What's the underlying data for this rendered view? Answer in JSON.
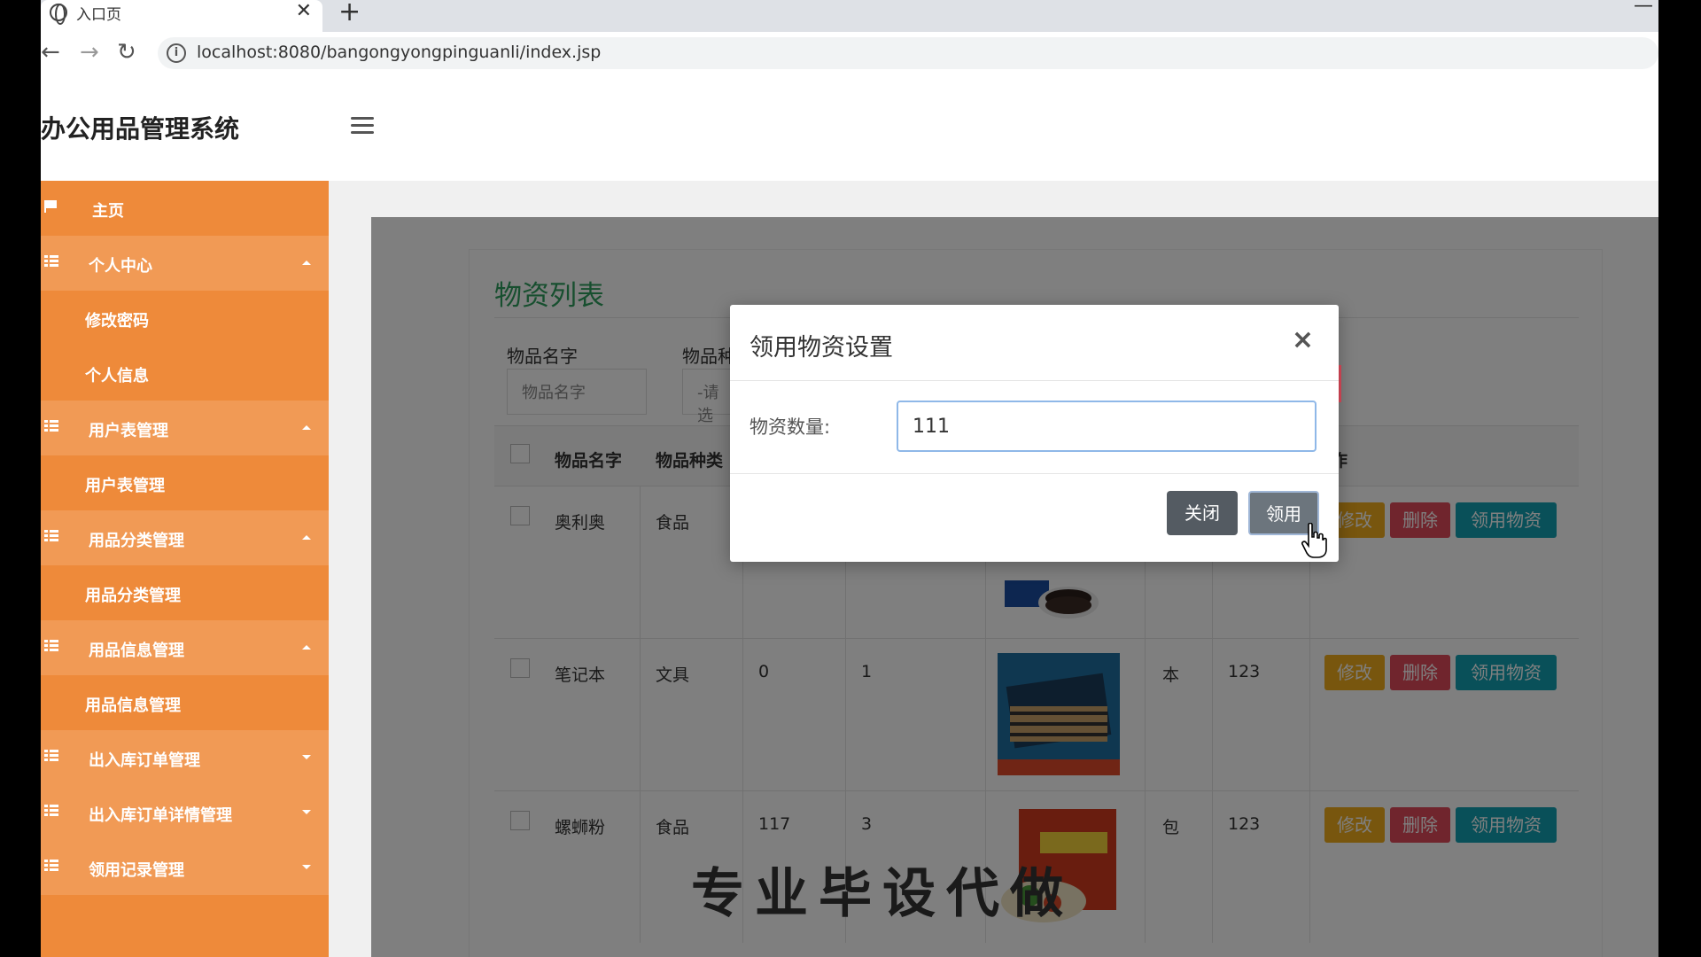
{
  "browser": {
    "tab_title": "入口页",
    "tab_close": "✕",
    "new_tab": "+",
    "url": "localhost:8080/bangongyongpinguanli/index.jsp",
    "minimize": "—"
  },
  "app": {
    "title": "办公用品管理系统"
  },
  "sidebar": {
    "items": [
      {
        "label": "主页",
        "kind": "home",
        "icon": "flag-icon"
      },
      {
        "label": "个人中心",
        "kind": "parent",
        "icon": "grid-icon",
        "caret": "up"
      },
      {
        "label": "修改密码",
        "kind": "child"
      },
      {
        "label": "个人信息",
        "kind": "child"
      },
      {
        "label": "用户表管理",
        "kind": "parent",
        "icon": "grid-icon",
        "caret": "up"
      },
      {
        "label": "用户表管理",
        "kind": "child"
      },
      {
        "label": "用品分类管理",
        "kind": "parent",
        "icon": "grid-icon",
        "caret": "up"
      },
      {
        "label": "用品分类管理",
        "kind": "child"
      },
      {
        "label": "用品信息管理",
        "kind": "parent",
        "icon": "grid-icon",
        "caret": "up"
      },
      {
        "label": "用品信息管理",
        "kind": "child"
      },
      {
        "label": "出入库订单管理",
        "kind": "parent",
        "icon": "grid-icon",
        "caret": "down"
      },
      {
        "label": "出入库订单详情管理",
        "kind": "parent",
        "icon": "grid-icon",
        "caret": "down"
      },
      {
        "label": "领用记录管理",
        "kind": "parent",
        "icon": "grid-icon",
        "caret": "down"
      }
    ]
  },
  "main": {
    "list_title": "物资列表",
    "search": {
      "name_label": "物品名字",
      "name_placeholder": "物品名字",
      "type_label": "物品种",
      "type_value": "-请选"
    },
    "table": {
      "headers": [
        "物品名字",
        "物品种类",
        "作"
      ],
      "rows": [
        {
          "name": "奥利奥",
          "type": "食品",
          "stock": "",
          "num": "",
          "unit": "",
          "price": ""
        },
        {
          "name": "笔记本",
          "type": "文具",
          "stock": "0",
          "num": "1",
          "unit": "本",
          "price": "123"
        },
        {
          "name": "螺蛳粉",
          "type": "食品",
          "stock": "117",
          "num": "3",
          "unit": "包",
          "price": "123"
        }
      ],
      "actions": {
        "edit": "修改",
        "delete": "删除",
        "take": "领用物资"
      }
    },
    "watermark": "专业毕设代做"
  },
  "modal": {
    "title": "领用物资设置",
    "close_icon": "×",
    "qty_label": "物资数量:",
    "qty_value": "111",
    "close_button": "关闭",
    "take_button": "领用"
  },
  "colors": {
    "sidebar": "#ee8a3a",
    "title_green": "#2f9e5e",
    "edit": "#f0ad1c",
    "delete": "#e04a5a",
    "take": "#13a0b2"
  }
}
